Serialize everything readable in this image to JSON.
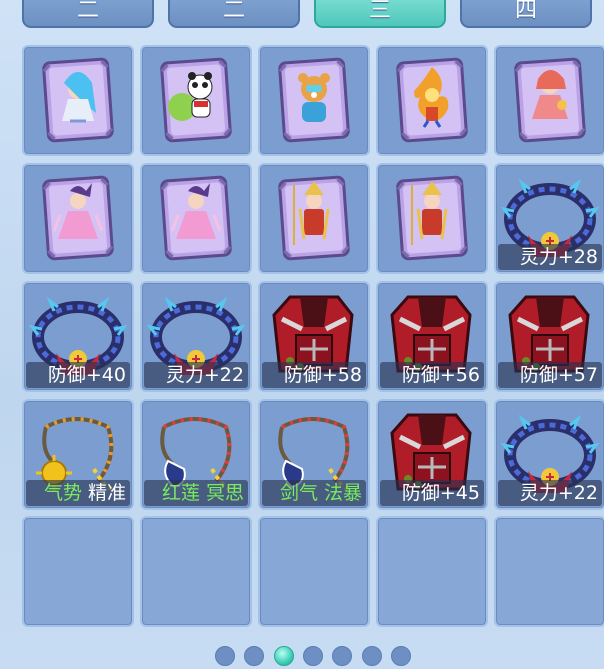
{
  "tabs": [
    {
      "label": "二",
      "active": false
    },
    {
      "label": "二",
      "active": false
    },
    {
      "label": "三",
      "active": true
    },
    {
      "label": "四",
      "active": false
    }
  ],
  "grid": {
    "rows": [
      [
        {
          "icon": "pet-card-girl-icon",
          "label": null
        },
        {
          "icon": "pet-card-panda-icon",
          "label": null
        },
        {
          "icon": "pet-card-bear-icon",
          "label": null
        },
        {
          "icon": "pet-card-fire-spirit-icon",
          "label": null
        },
        {
          "icon": "pet-card-pink-warrior-icon",
          "label": null
        }
      ],
      [
        {
          "icon": "pet-card-dancer-icon",
          "label": null
        },
        {
          "icon": "pet-card-dancer-icon",
          "label": null
        },
        {
          "icon": "pet-card-golden-warrior-icon",
          "label": null
        },
        {
          "icon": "pet-card-golden-warrior-icon",
          "label": null
        },
        {
          "icon": "bracelet-icon",
          "label": {
            "white": "灵力+28"
          }
        }
      ],
      [
        {
          "icon": "bracelet-icon",
          "label": {
            "white": "防御+40"
          }
        },
        {
          "icon": "bracelet-icon",
          "label": {
            "white": "灵力+22"
          }
        },
        {
          "icon": "armor-icon",
          "label": {
            "white": "防御+58"
          }
        },
        {
          "icon": "armor-icon",
          "label": {
            "white": "防御+56"
          }
        },
        {
          "icon": "armor-icon",
          "label": {
            "white": "防御+57"
          }
        }
      ],
      [
        {
          "icon": "necklace-sun-icon",
          "label": {
            "green": "气势",
            "white": " 精准"
          }
        },
        {
          "icon": "necklace-icon",
          "label": {
            "green": "红莲 冥思",
            "white": ""
          }
        },
        {
          "icon": "necklace-icon",
          "label": {
            "green": "剑气 法暴",
            "white": ""
          }
        },
        {
          "icon": "armor-icon",
          "label": {
            "white": "防御+45"
          }
        },
        {
          "icon": "bracelet-icon",
          "label": {
            "white": "灵力+22"
          }
        }
      ],
      [
        {
          "icon": null,
          "label": null
        },
        {
          "icon": null,
          "label": null
        },
        {
          "icon": null,
          "label": null
        },
        {
          "icon": null,
          "label": null
        },
        {
          "icon": null,
          "label": null
        }
      ]
    ]
  },
  "pagination": {
    "count": 7,
    "active_index": 2
  },
  "colors": {
    "label_green": "#78ec5c",
    "active_tab": "#4fc7bb",
    "slot_bg": "#7b9dcf"
  }
}
